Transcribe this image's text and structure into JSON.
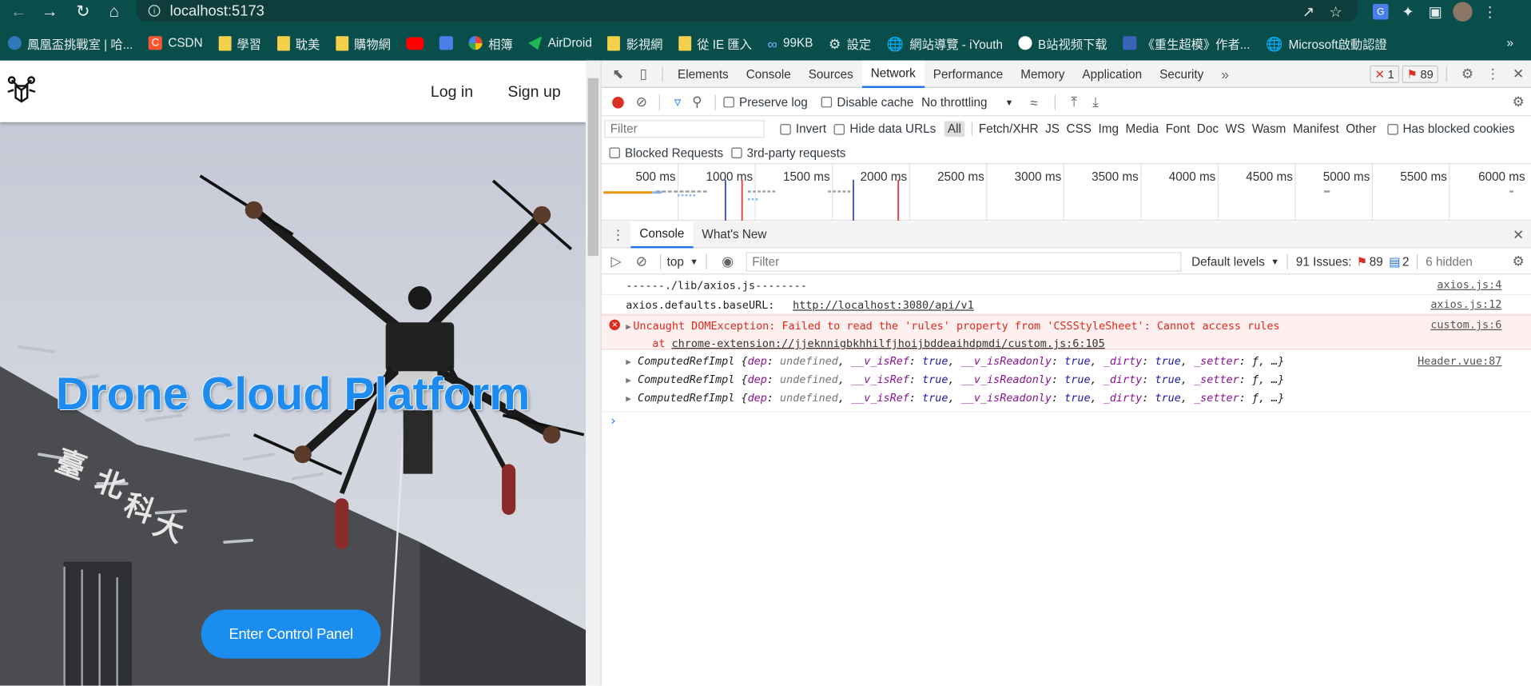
{
  "browser": {
    "url": "localhost:5173",
    "bookmarks": [
      "鳳凰盃挑戰室 | 哈...",
      "CSDN",
      "學習",
      "耽美",
      "購物網",
      "",
      "",
      "相簿",
      "AirDroid",
      "影視網",
      "從 IE 匯入",
      "99KB",
      "設定",
      "網站導覽 - iYouth",
      "B站视频下载",
      "《重生超模》作者...",
      "Microsoft啟動認證"
    ],
    "more": "»"
  },
  "page": {
    "login": "Log in",
    "signup": "Sign up",
    "title": "Drone Cloud Platform",
    "cta": "Enter Control Panel"
  },
  "devtools": {
    "tabs": [
      "Elements",
      "Console",
      "Sources",
      "Network",
      "Performance",
      "Memory",
      "Application",
      "Security"
    ],
    "active_tab": "Network",
    "errors_count": "1",
    "issues_count": "89",
    "preserve_log": "Preserve log",
    "disable_cache": "Disable cache",
    "throttling": "No throttling",
    "filter_placeholder": "Filter",
    "invert": "Invert",
    "hide_data_urls": "Hide data URLs",
    "types": [
      "All",
      "Fetch/XHR",
      "JS",
      "CSS",
      "Img",
      "Media",
      "Font",
      "Doc",
      "WS",
      "Wasm",
      "Manifest",
      "Other"
    ],
    "has_blocked_cookies": "Has blocked cookies",
    "blocked_requests": "Blocked Requests",
    "third_party": "3rd-party requests",
    "timeline_labels": [
      "500 ms",
      "1000 ms",
      "1500 ms",
      "2000 ms",
      "2500 ms",
      "3000 ms",
      "3500 ms",
      "4000 ms",
      "4500 ms",
      "5000 ms",
      "5500 ms",
      "6000 ms"
    ],
    "drawer_tabs": [
      "Console",
      "What's New"
    ],
    "context": "top",
    "console_filter": "Filter",
    "levels": "Default levels",
    "issues_label": "91 Issues:",
    "issues_err": "89",
    "issues_info": "2",
    "hidden": "6 hidden",
    "messages": {
      "m1": "------./lib/axios.js--------",
      "m1_src": "axios.js:4",
      "m2_key": "axios.defaults.baseURL:",
      "m2_url": "http://localhost:3080/api/v1",
      "m2_src": "axios.js:12",
      "err_line1": "Uncaught DOMException: Failed to read the 'rules' property from 'CSSStyleSheet': Cannot access rules",
      "err_at": "at",
      "err_link": "chrome-extension://jjeknnigbkhhilfjhoijbddeaihdpmdi/custom.js:6:105",
      "err_src": "custom.js:6",
      "ref_name": "ComputedRefImpl",
      "ref_src": "Header.vue:87"
    }
  }
}
